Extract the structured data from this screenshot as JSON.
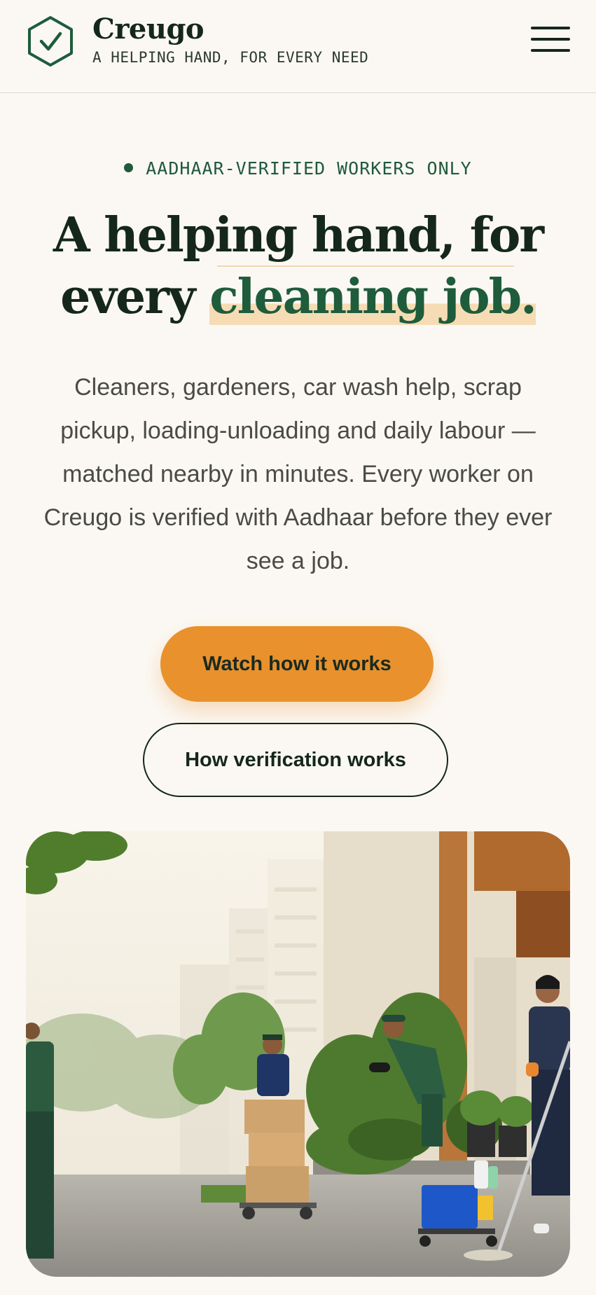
{
  "header": {
    "brand_name": "Creugo",
    "tagline": "A HELPING HAND, FOR EVERY NEED",
    "logo_icon": "hexagon-check-icon",
    "menu_icon": "hamburger-menu-icon"
  },
  "hero": {
    "eyebrow": "AADHAAR-VERIFIED WORKERS ONLY",
    "headline_line1": "A helping hand, for",
    "headline_line2_plain": "every ",
    "headline_line2_highlight": "cleaning job.",
    "description": "Cleaners, gardeners, car wash help, scrap pickup, loading-unloading and daily labour — matched nearby in minutes. Every worker on Creugo is verified with Aadhaar before they ever see a job.",
    "primary_cta": "Watch how it works",
    "secondary_cta": "How verification works"
  },
  "colors": {
    "background": "#fbf8f3",
    "brand_green": "#1e5c3b",
    "accent_orange": "#e8912d",
    "highlight": "#f5dcb4",
    "text_dark": "#15271d"
  }
}
